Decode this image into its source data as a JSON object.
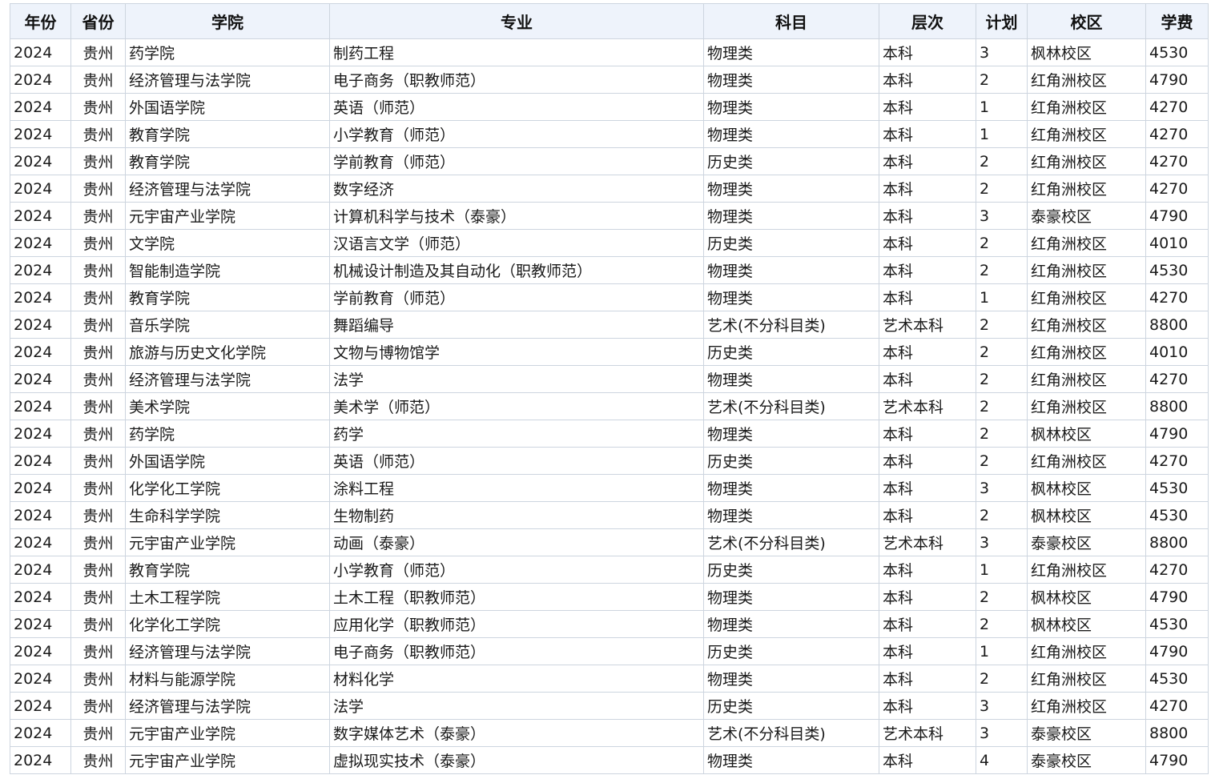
{
  "table": {
    "headers": [
      "年份",
      "省份",
      "学院",
      "专业",
      "科目",
      "层次",
      "计划",
      "校区",
      "学费"
    ],
    "rows": [
      [
        "2024",
        "贵州",
        "药学院",
        "制药工程",
        "物理类",
        "本科",
        "3",
        "枫林校区",
        "4530"
      ],
      [
        "2024",
        "贵州",
        "经济管理与法学院",
        "电子商务（职教师范）",
        "物理类",
        "本科",
        "2",
        "红角洲校区",
        "4790"
      ],
      [
        "2024",
        "贵州",
        "外国语学院",
        "英语（师范）",
        "物理类",
        "本科",
        "1",
        "红角洲校区",
        "4270"
      ],
      [
        "2024",
        "贵州",
        "教育学院",
        "小学教育（师范）",
        "物理类",
        "本科",
        "1",
        "红角洲校区",
        "4270"
      ],
      [
        "2024",
        "贵州",
        "教育学院",
        "学前教育（师范）",
        "历史类",
        "本科",
        "2",
        "红角洲校区",
        "4270"
      ],
      [
        "2024",
        "贵州",
        "经济管理与法学院",
        "数字经济",
        "物理类",
        "本科",
        "2",
        "红角洲校区",
        "4270"
      ],
      [
        "2024",
        "贵州",
        "元宇宙产业学院",
        "计算机科学与技术（泰豪）",
        "物理类",
        "本科",
        "3",
        "泰豪校区",
        "4790"
      ],
      [
        "2024",
        "贵州",
        "文学院",
        "汉语言文学（师范）",
        "历史类",
        "本科",
        "2",
        "红角洲校区",
        "4010"
      ],
      [
        "2024",
        "贵州",
        "智能制造学院",
        "机械设计制造及其自动化（职教师范）",
        "物理类",
        "本科",
        "2",
        "红角洲校区",
        "4530"
      ],
      [
        "2024",
        "贵州",
        "教育学院",
        "学前教育（师范）",
        "物理类",
        "本科",
        "1",
        "红角洲校区",
        "4270"
      ],
      [
        "2024",
        "贵州",
        "音乐学院",
        "舞蹈编导",
        "艺术(不分科目类)",
        "艺术本科",
        "2",
        "红角洲校区",
        "8800"
      ],
      [
        "2024",
        "贵州",
        "旅游与历史文化学院",
        "文物与博物馆学",
        "历史类",
        "本科",
        "2",
        "红角洲校区",
        "4010"
      ],
      [
        "2024",
        "贵州",
        "经济管理与法学院",
        "法学",
        "物理类",
        "本科",
        "2",
        "红角洲校区",
        "4270"
      ],
      [
        "2024",
        "贵州",
        "美术学院",
        "美术学（师范）",
        "艺术(不分科目类)",
        "艺术本科",
        "2",
        "红角洲校区",
        "8800"
      ],
      [
        "2024",
        "贵州",
        "药学院",
        "药学",
        "物理类",
        "本科",
        "2",
        "枫林校区",
        "4790"
      ],
      [
        "2024",
        "贵州",
        "外国语学院",
        "英语（师范）",
        "历史类",
        "本科",
        "2",
        "红角洲校区",
        "4270"
      ],
      [
        "2024",
        "贵州",
        "化学化工学院",
        "涂料工程",
        "物理类",
        "本科",
        "3",
        "枫林校区",
        "4530"
      ],
      [
        "2024",
        "贵州",
        "生命科学学院",
        "生物制药",
        "物理类",
        "本科",
        "2",
        "枫林校区",
        "4530"
      ],
      [
        "2024",
        "贵州",
        "元宇宙产业学院",
        "动画（泰豪）",
        "艺术(不分科目类)",
        "艺术本科",
        "3",
        "泰豪校区",
        "8800"
      ],
      [
        "2024",
        "贵州",
        "教育学院",
        "小学教育（师范）",
        "历史类",
        "本科",
        "1",
        "红角洲校区",
        "4270"
      ],
      [
        "2024",
        "贵州",
        "土木工程学院",
        "土木工程（职教师范）",
        "物理类",
        "本科",
        "2",
        "枫林校区",
        "4790"
      ],
      [
        "2024",
        "贵州",
        "化学化工学院",
        "应用化学（职教师范）",
        "物理类",
        "本科",
        "2",
        "枫林校区",
        "4530"
      ],
      [
        "2024",
        "贵州",
        "经济管理与法学院",
        "电子商务（职教师范）",
        "历史类",
        "本科",
        "1",
        "红角洲校区",
        "4790"
      ],
      [
        "2024",
        "贵州",
        "材料与能源学院",
        "材料化学",
        "物理类",
        "本科",
        "2",
        "红角洲校区",
        "4530"
      ],
      [
        "2024",
        "贵州",
        "经济管理与法学院",
        "法学",
        "历史类",
        "本科",
        "3",
        "红角洲校区",
        "4270"
      ],
      [
        "2024",
        "贵州",
        "元宇宙产业学院",
        "数字媒体艺术（泰豪）",
        "艺术(不分科目类)",
        "艺术本科",
        "3",
        "泰豪校区",
        "8800"
      ],
      [
        "2024",
        "贵州",
        "元宇宙产业学院",
        "虚拟现实技术（泰豪）",
        "物理类",
        "本科",
        "4",
        "泰豪校区",
        "4790"
      ]
    ]
  }
}
